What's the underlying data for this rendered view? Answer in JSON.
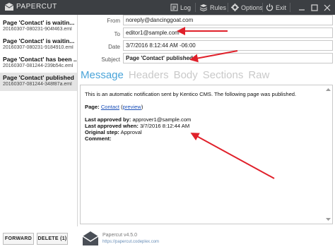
{
  "app": {
    "title": "PAPERCUT",
    "toolbar": [
      {
        "label": "Log",
        "icon": "log-icon"
      },
      {
        "label": "Rules",
        "icon": "rules-icon"
      },
      {
        "label": "Options",
        "icon": "gear-icon"
      },
      {
        "label": "Exit",
        "icon": "power-icon"
      }
    ]
  },
  "messages": [
    {
      "subject": "Page 'Contact' is waitin...",
      "file": "20160307-080231-904f463.eml",
      "selected": false
    },
    {
      "subject": "Page 'Contact' is waitin...",
      "file": "20160307-080231-9184910.eml",
      "selected": false
    },
    {
      "subject": "Page 'Contact' has been ...",
      "file": "20160307-081244-239b54c.eml",
      "selected": false
    },
    {
      "subject": "Page 'Contact' published",
      "file": "20160307-081244-348f87a.eml",
      "selected": true
    }
  ],
  "header": {
    "from_label": "From",
    "from_value": "noreply@dancinggoat.com",
    "to_label": "To",
    "to_value": "editor1@sample.com",
    "date_label": "Date",
    "date_value": "3/7/2016 8:12:44 AM -06:00",
    "subject_label": "Subject",
    "subject_value": "Page 'Contact' published"
  },
  "tabs": [
    {
      "label": "Message",
      "active": true
    },
    {
      "label": "Headers",
      "active": false
    },
    {
      "label": "Body",
      "active": false
    },
    {
      "label": "Sections",
      "active": false
    },
    {
      "label": "Raw",
      "active": false
    }
  ],
  "body": {
    "intro": "This is an automatic notification sent by Kentico CMS. The following page was published.",
    "page_label": "Page:",
    "page_link": "Contact",
    "page_preview_open": "(",
    "page_preview": "preview",
    "page_preview_close": ")",
    "approved_by_label": "Last approved by:",
    "approved_by_value": "approver1@sample.com",
    "approved_when_label": "Last approved when:",
    "approved_when_value": "3/7/2016 8:12:44 AM",
    "step_label": "Original step:",
    "step_value": "Approval",
    "comment_label": "Comment:"
  },
  "actions": {
    "forward": "FORWARD",
    "delete": "DELETE (1)"
  },
  "footer": {
    "name": "Papercut v4.5.0",
    "url": "https://papercut.codeplex.com"
  },
  "colors": {
    "titlebar": "#3c3f43",
    "active_tab": "#4aa4d9",
    "inactive_tab": "#c9c9c9",
    "arrow": "#e0202a",
    "selected_row": "#e4e4e4"
  }
}
